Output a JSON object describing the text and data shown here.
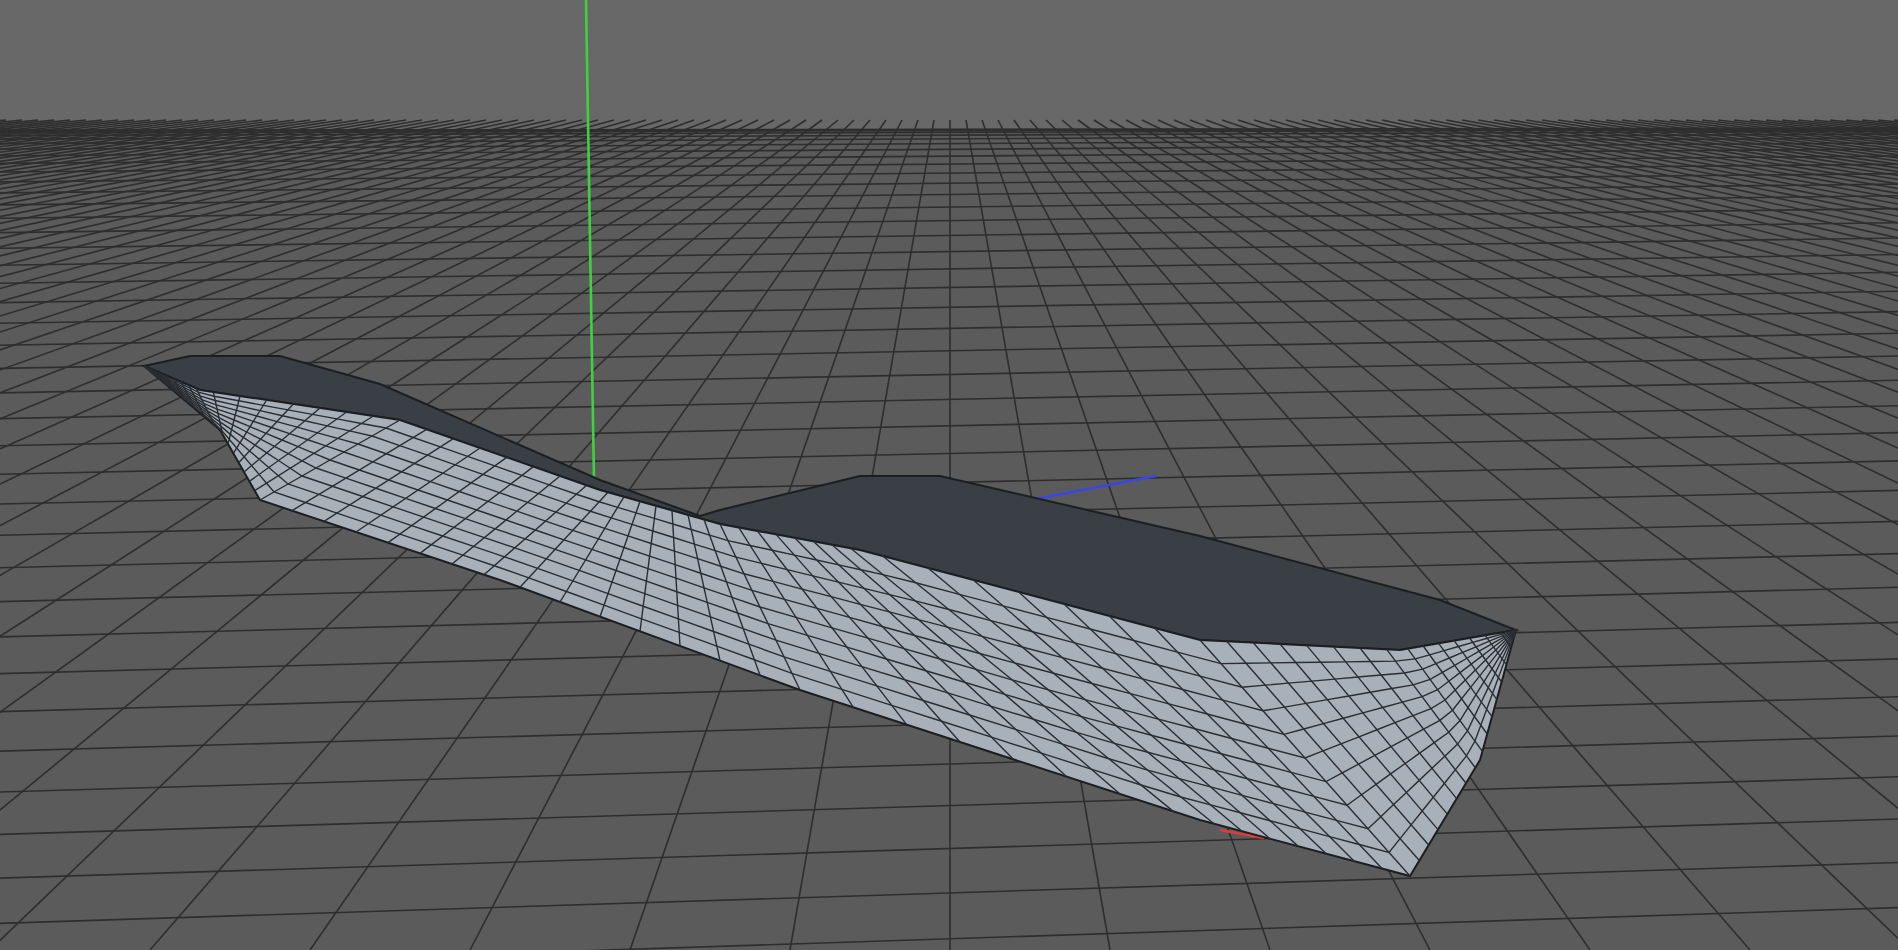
{
  "viewport": {
    "grid": true,
    "axes": true,
    "wireframe": true
  }
}
